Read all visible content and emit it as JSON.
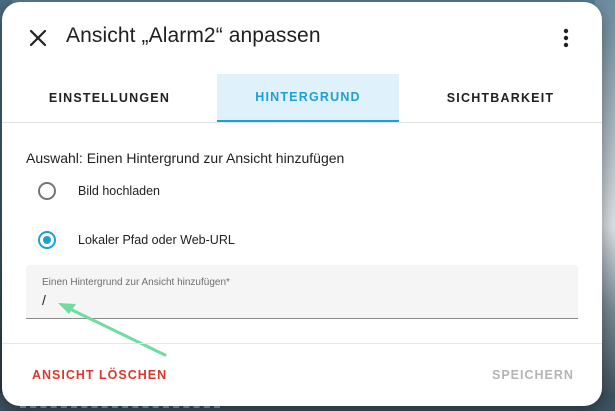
{
  "dialog": {
    "title": "Ansicht „Alarm2“ anpassen",
    "close_icon": "close-icon",
    "menu_icon": "more-vertical-icon"
  },
  "tabs": [
    {
      "label": "EINSTELLUNGEN",
      "active": false
    },
    {
      "label": "HINTERGRUND",
      "active": true
    },
    {
      "label": "SICHTBARKEIT",
      "active": false
    }
  ],
  "background": {
    "question": "Auswahl: Einen Hintergrund zur Ansicht hinzufügen",
    "options": [
      {
        "label": "Bild hochladen",
        "selected": false
      },
      {
        "label": "Lokaler Pfad oder Web-URL",
        "selected": true
      }
    ],
    "input": {
      "label": "Einen Hintergrund zur Ansicht hinzufügen*",
      "value": "/"
    }
  },
  "footer": {
    "delete_label": "ANSICHT LÖSCHEN",
    "save_label": "SPEICHERN"
  },
  "colors": {
    "accent": "#1e9fd9",
    "tab_active_bg": "#dff1fa",
    "danger": "#d9382d",
    "disabled": "#b5b5b5",
    "annotation_arrow": "#6fdca0"
  }
}
